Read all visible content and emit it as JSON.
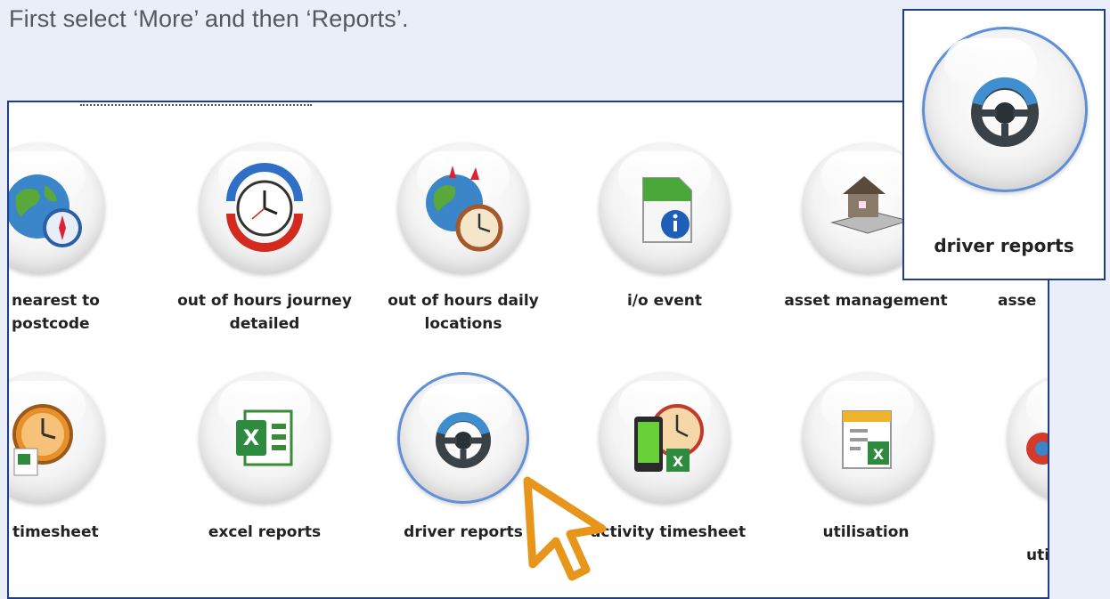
{
  "instruction": "First select ‘More’ and then ‘Reports’.",
  "row1": [
    {
      "label": "nearest to postcode",
      "icon": "globe-compass-icon"
    },
    {
      "label": "out of hours journey detailed",
      "icon": "clock-arrow-icon"
    },
    {
      "label": "out of hours daily locations",
      "icon": "globe-clock-icon"
    },
    {
      "label": "i/o event",
      "icon": "info-document-icon"
    },
    {
      "label": "asset management",
      "icon": "house-calculator-icon"
    },
    {
      "label": "asse",
      "icon": "unknown-icon"
    }
  ],
  "row2": [
    {
      "label": "timesheet",
      "icon": "clock-spreadsheet-icon"
    },
    {
      "label": "excel reports",
      "icon": "excel-icon"
    },
    {
      "label": "driver reports",
      "icon": "steering-wheel-icon",
      "selected": true
    },
    {
      "label": "activity timesheet",
      "icon": "phone-clock-excel-icon"
    },
    {
      "label": "utilisation",
      "icon": "document-excel-icon"
    },
    {
      "label": "uti",
      "icon": "unknown-icon"
    }
  ],
  "zoom": {
    "label": "driver reports",
    "icon": "steering-wheel-icon"
  },
  "colors": {
    "frame": "#1e3d8c",
    "selected_ring": "#5f8fd6",
    "cursor": "#e8951c"
  }
}
